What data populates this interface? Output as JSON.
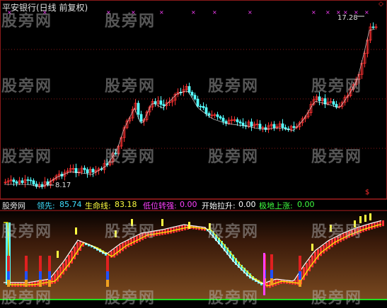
{
  "title": "平安银行(日线 前复权)",
  "price_labels": {
    "high": "17.28",
    "low": "8.17"
  },
  "corner_marker": "◇",
  "signal_glyph": "$",
  "watermark": "股旁网",
  "indicator": {
    "name": "股旁网",
    "fields": [
      {
        "label": "领先:",
        "value": "85.74",
        "color": "#40e0ff"
      },
      {
        "label": "生命线:",
        "value": "83.18",
        "color": "#ffff40"
      },
      {
        "label": "低位转强:",
        "value": "0.00",
        "color": "#ff40ff"
      },
      {
        "label": "开始拉升:",
        "value": "0.00",
        "color": "#ffffff"
      },
      {
        "label": "极地上涨:",
        "value": "0.00",
        "color": "#40ff40"
      }
    ]
  },
  "colors": {
    "up": "#ff3232",
    "down": "#54ffff",
    "ma": "#ffffff",
    "grid": "#8b1a1a",
    "lead_line": "#ffffff",
    "life_line": "#ffff00",
    "marker": "#ff40ff"
  }
}
